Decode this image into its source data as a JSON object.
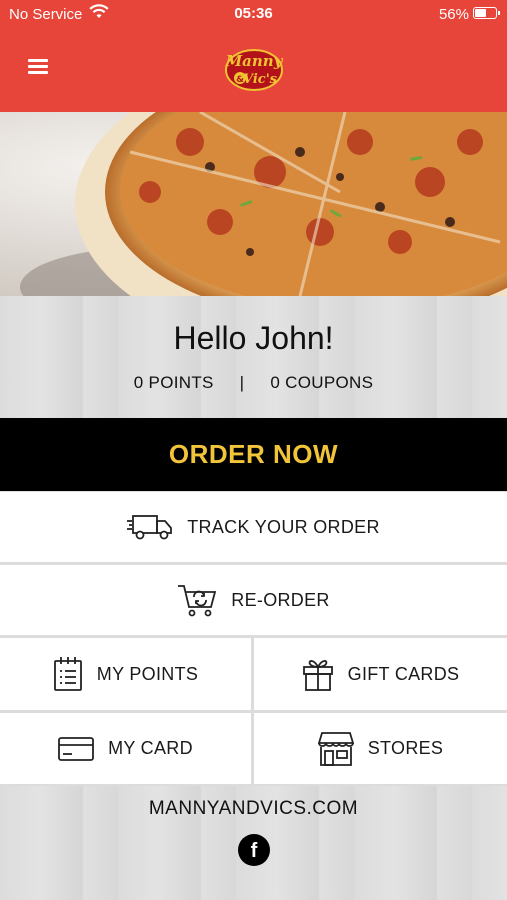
{
  "status_bar": {
    "carrier": "No Service",
    "time": "05:36",
    "battery": "56%"
  },
  "header": {
    "menu_icon": "hamburger-menu-icon",
    "logo_text_top": "Manny",
    "logo_text_amp": "&",
    "logo_text_bottom": "Vic's",
    "brand_color": "#e8453a"
  },
  "greeting": {
    "text": "Hello John!",
    "points": "0 POINTS",
    "separator": "|",
    "coupons": "0 COUPONS"
  },
  "order_now": {
    "label": "ORDER NOW",
    "text_color": "#f2c43a"
  },
  "actions": {
    "track_order": {
      "label": "TRACK YOUR ORDER",
      "icon": "delivery-truck-icon"
    },
    "reorder": {
      "label": "RE-ORDER",
      "icon": "cart-refresh-icon"
    },
    "my_points": {
      "label": "MY POINTS",
      "icon": "notepad-icon"
    },
    "gift_cards": {
      "label": "GIFT CARDS",
      "icon": "gift-icon"
    },
    "my_card": {
      "label": "MY CARD",
      "icon": "credit-card-icon"
    },
    "stores": {
      "label": "STORES",
      "icon": "storefront-icon"
    }
  },
  "footer": {
    "website": "MANNYANDVICS.COM",
    "facebook_icon": "f"
  }
}
